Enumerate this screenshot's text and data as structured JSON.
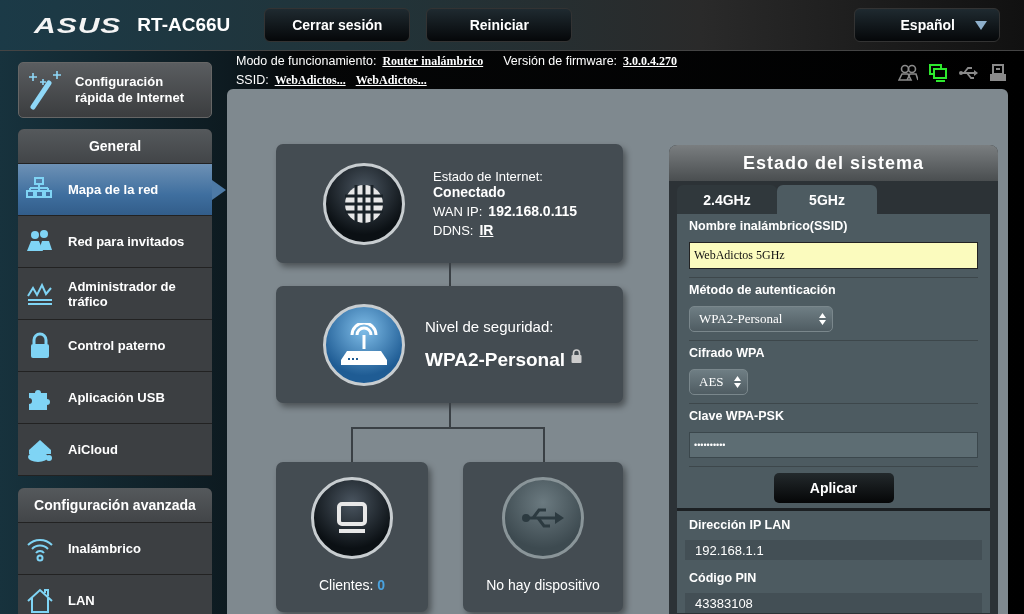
{
  "header": {
    "logo": "ASUS",
    "model": "RT-AC66U",
    "buttons": [
      "Cerrar sesión",
      "Reiniciar"
    ],
    "language": "Español"
  },
  "info": {
    "mode_label": "Modo de funcionamiento:",
    "mode_value": "Router inalámbrico",
    "firmware_label": "Versión de firmware:",
    "firmware_value": "3.0.0.4.270",
    "ssid_label": "SSID:",
    "ssids": [
      "WebAdictos...",
      "WebAdictos..."
    ]
  },
  "status_icons": [
    {
      "kind": "clients",
      "on": false
    },
    {
      "kind": "network",
      "on": true
    },
    {
      "kind": "usb",
      "on": false
    },
    {
      "kind": "printer",
      "on": false
    }
  ],
  "sidebar": {
    "quick_setup": "Configuración rápida de Internet",
    "sections": [
      {
        "title": "General",
        "items": [
          {
            "label": "Mapa de la red",
            "kind": "map",
            "selected": true
          },
          {
            "label": "Red para invitados",
            "kind": "guests",
            "selected": false
          },
          {
            "label": "Administrador de tráfico",
            "kind": "traffic",
            "selected": false
          },
          {
            "label": "Control paterno",
            "kind": "lock",
            "selected": false
          },
          {
            "label": "Aplicación USB",
            "kind": "puzzle",
            "selected": false
          },
          {
            "label": "AiCloud",
            "kind": "cloud",
            "selected": false
          }
        ]
      },
      {
        "title": "Configuración avanzada",
        "items": [
          {
            "label": "Inalámbrico",
            "kind": "wifi",
            "selected": false
          },
          {
            "label": "LAN",
            "kind": "home",
            "selected": false
          }
        ]
      }
    ]
  },
  "map": {
    "internet": {
      "status_label": "Estado de Internet:",
      "status": "Conectado",
      "wan_label": "WAN IP:",
      "wan_ip": "192.168.0.115",
      "ddns_label": "DDNS:",
      "ddns": "IR"
    },
    "security": {
      "label": "Nivel de seguridad:",
      "value": "WPA2-Personal",
      "locked": true
    },
    "clients": {
      "label": "Clientes:",
      "count": "0"
    },
    "usb": {
      "label": "No hay dispositivo",
      "connected": false
    }
  },
  "system": {
    "title": "Estado del sistema",
    "tabs": [
      {
        "label": "2.4GHz",
        "selected": false
      },
      {
        "label": "5GHz",
        "selected": true
      }
    ],
    "fields": [
      {
        "kind": "text",
        "label": "Nombre inalámbrico(SSID)",
        "value": "WebAdictos 5GHz"
      },
      {
        "kind": "select",
        "label": "Método de autenticación",
        "value": "WPA2-Personal"
      },
      {
        "kind": "select",
        "label": "Cifrado WPA",
        "value": "AES"
      },
      {
        "kind": "password",
        "label": "Clave WPA-PSK",
        "value": "••••••••••"
      }
    ],
    "apply": "Aplicar",
    "info": [
      {
        "label": "Dirección IP LAN",
        "value": "192.168.1.1"
      },
      {
        "label": "Código PIN",
        "value": "43383108"
      }
    ]
  }
}
